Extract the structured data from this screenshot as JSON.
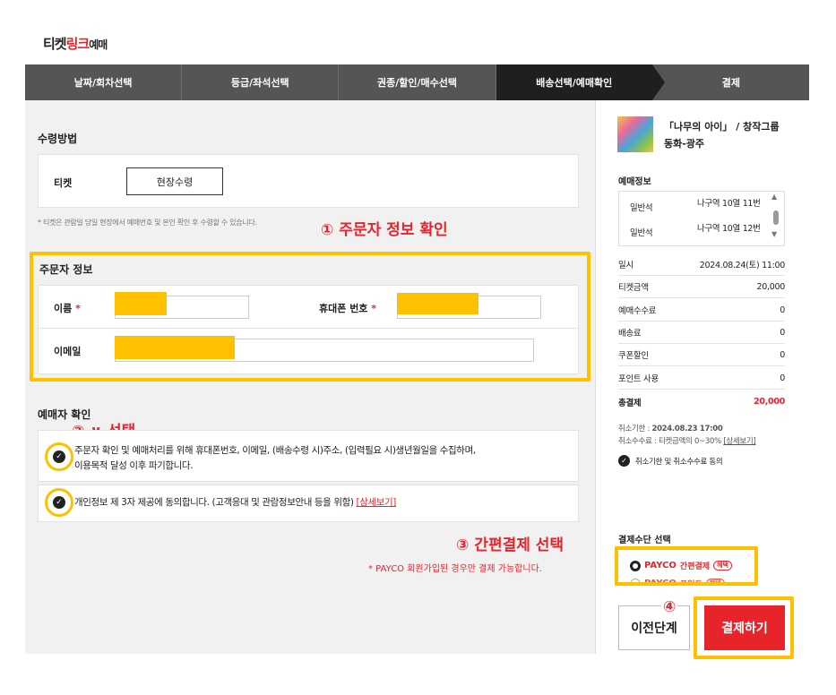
{
  "header": {
    "logo_part1": "티켓",
    "logo_part2": "링크",
    "logo_part3": "예매"
  },
  "steps": [
    {
      "label": "날짜/회차선택",
      "active": false
    },
    {
      "label": "등급/좌석선택",
      "active": false
    },
    {
      "label": "권종/할인/매수선택",
      "active": false
    },
    {
      "label": "배송선택/예매확인",
      "active": true
    },
    {
      "label": "결제",
      "active": false
    }
  ],
  "receive": {
    "title": "수령방법",
    "ticket_label": "티켓",
    "method_button": "현장수령",
    "note": "* 티켓은 관람일 당일 현장에서 예매번호 및 본인 확인 후 수령할 수 있습니다."
  },
  "orderer": {
    "title": "주문자 정보",
    "name_label": "이름",
    "phone_label": "휴대폰 번호",
    "email_label": "이메일",
    "required_mark": "*"
  },
  "confirm": {
    "title": "예매자 확인",
    "consent1_line1": "주문자 확인 및 예매처리를 위해 휴대폰번호, 이메일, (배송수령 시)주소, (입력필요 시)생년월일을 수집하며,",
    "consent1_line2": "이용목적 달성 이후 파기합니다.",
    "consent2_text": "개인정보 제 3자 제공에 동의합니다. (고객응대 및 관람정보안내 등을 위함)",
    "consent2_link": "[상세보기]"
  },
  "callouts": {
    "c1": "① 주문자 정보 확인",
    "c2": "②  ∨ 선택",
    "c3": "③ 간편결제 선택",
    "c3_note": "* PAYCO 회원가입된 경우만 결제 가능합니다.",
    "c4": "④"
  },
  "show": {
    "title": "「나무의 아이」 / 창작그룹 동화-광주"
  },
  "booking": {
    "title": "예매정보",
    "seats": [
      {
        "grade": "일반석",
        "seat": "나구역 10열 11번"
      },
      {
        "grade": "일반석",
        "seat": "나구역 10열 12번"
      }
    ],
    "rows": [
      {
        "label": "일시",
        "value": "2024.08.24(토) 11:00"
      },
      {
        "label": "티켓금액",
        "value": "20,000"
      },
      {
        "label": "예매수수료",
        "value": "0"
      },
      {
        "label": "배송료",
        "value": "0"
      },
      {
        "label": "쿠폰할인",
        "value": "0"
      },
      {
        "label": "포인트 사용",
        "value": "0"
      }
    ],
    "total_label": "총결제",
    "total_value": "20,000",
    "cancel_deadline_label": "취소기한 : ",
    "cancel_deadline_value": "2024.08.23 17:00",
    "cancel_fee_label": "취소수수료 : 티켓금액의 0~30%",
    "cancel_fee_link": "[상세보기]",
    "agree_text": "취소기한 및 취소수수료 동의"
  },
  "payment": {
    "title": "결제수단 선택",
    "option1_brand": "PAYCO",
    "option1_label": "간편결제",
    "option1_badge": "혜택",
    "option2_brand": "PAYCO",
    "option2_label": "포인트",
    "option2_badge": "혜택"
  },
  "buttons": {
    "prev": "이전단계",
    "pay": "결제하기"
  },
  "colors": {
    "accent": "#e8242b",
    "highlight": "#ffc000",
    "step_bg": "#555555",
    "step_active_bg": "#1f1f1f"
  }
}
